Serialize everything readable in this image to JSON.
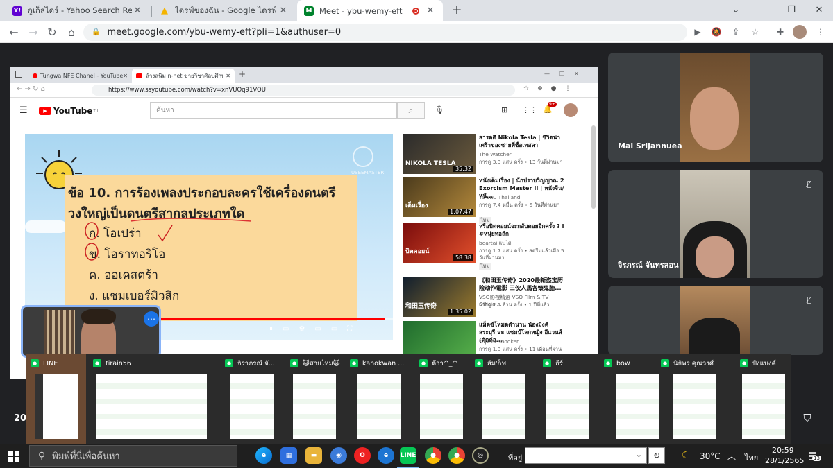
{
  "browser": {
    "tabs": [
      {
        "favicon": "Y!",
        "title": "กูเก็ลไดร์ - Yahoo Search Results Ya",
        "color": "#6001d2"
      },
      {
        "favicon": "▲",
        "title": "ไดรฟ์ของฉัน - Google ไดรฟ์",
        "color": "#f4b400"
      },
      {
        "favicon": "M",
        "title": "Meet - ybu-wemy-eft",
        "color": "#00832d"
      }
    ],
    "new_tab": "+",
    "url": "meet.google.com/ybu-wemy-eft?pli=1&authuser=0"
  },
  "shared_screen": {
    "tabs": [
      "Tungwa NFE Chanel - YouTube",
      "ล้างสนิม n-net ขายวิชาศิลปศึกษา เรียน"
    ],
    "url": "https://www.ssyoutube.com/watch?v=xnVUOq91VOU",
    "youtube": {
      "logo": "YouTube",
      "logo_sup": "TH",
      "search_placeholder": "ค้นหา",
      "notif_count": "9+"
    },
    "lesson": {
      "watermark": "USEEMASTER",
      "question_line1": "ข้อ 10. การร้องเพลงประกอบละครใช้เครื่องดนตรี",
      "question_line2": "วงใหญ่เป็นดนตรีสากลประเภทใด",
      "options": [
        "ก. โอเปร่า",
        "ข. โอราทอริโอ",
        "ค. ออเคสตร้า",
        "ง. แชมเบอร์มิวสิก"
      ],
      "progress": 0.98
    },
    "videos": [
      {
        "title": "สารคดี Nikola Tesla | ชีวิตน่าเศร้าของชายที่ชื่อเทสลา",
        "channel": "The Watcher",
        "meta": "การดู 3.3 แสน ครั้ง • 13 วันที่ผ่านมา",
        "duration": "35:32",
        "thumb_text": "NIKOLA TESLA"
      },
      {
        "title": "หนังเต็มเรื่อง | นักปราบวิญญาณ 2 Exorcism Master II | หนังจีน/หนั...",
        "channel": "YOUKU Thailand",
        "meta": "การดู 7.4 หมื่น ครั้ง • 5 วันที่ผ่านมา",
        "badge": "ใหม่",
        "duration": "1:07:47",
        "thumb_text": "เต็มเรื่อง"
      },
      {
        "title": "หรือบิตคอยน์จะกลับดอยอีกครั้ง ? l #หนุ่ยทอล์ก",
        "channel": "beartai แบไต๋",
        "meta": "การดู 1.7 แสน ครั้ง • สตรีมแล้วเมื่อ 5 วันที่ผ่านมา",
        "badge": "ใหม่",
        "duration": "58:38",
        "thumb_text": "บิตคอยน์"
      },
      {
        "title": "《和田玉传奇》2020最新盗宝历险动作電影 三伙人馬各懷鬼胎...",
        "channel": "VSO影視精選 VSO Film & TV Official...",
        "meta": "การดู 2.1 ล้าน ครั้ง • 1 ปีที่แล้ว",
        "duration": "1:35:02",
        "thumb_text": "和田玉传奇"
      },
      {
        "title": "แม็คซ์โหมดตำนาน น้องมิงค์ สระบุรี vs แชมป์โลกหญิง อีแวนส์ (ตัดต่อ...",
        "channel": "super1 snooker",
        "meta": "การดู 1.3 แสน ครั้ง • 11 เดือนที่ผ่านมา",
        "duration": "",
        "thumb_text": ""
      }
    ]
  },
  "participants": [
    {
      "name": "Mai Srijannuea",
      "muted": false
    },
    {
      "name": "จิรภรณ์ จันทรสอน",
      "muted": true
    },
    {
      "name": "",
      "muted": true
    }
  ],
  "meet_clock_partial": "20",
  "switcher": [
    {
      "label": "LINE",
      "selected": true
    },
    {
      "label": "tirain56"
    },
    {
      "label": "จิราภรณ์ จั..."
    },
    {
      "label": "😺สายไหม😺"
    },
    {
      "label": "kanokwan ..."
    },
    {
      "label": "ต้าา^_^"
    },
    {
      "label": "ส้ม'ก็ฟ"
    },
    {
      "label": "อีร์"
    },
    {
      "label": "bow"
    },
    {
      "label": "นิธิพร คุณวงศ์"
    },
    {
      "label": "ปังแบงค์"
    }
  ],
  "taskbar": {
    "search_placeholder": "พิมพ์ที่นี่เพื่อค้นหา",
    "address_label": "ที่อยู่",
    "temperature": "30°C",
    "language": "ไทย",
    "time": "20:59",
    "date": "28/1/2565",
    "notifications": "13"
  }
}
